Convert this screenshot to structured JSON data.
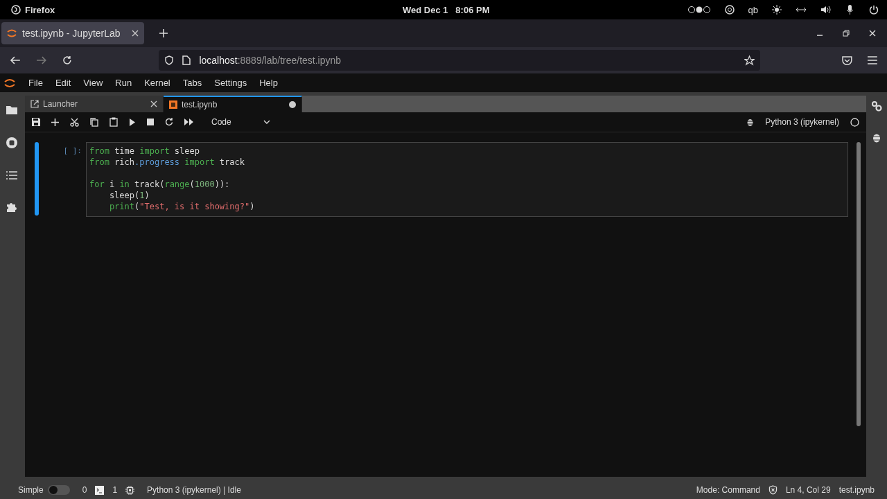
{
  "system_bar": {
    "app": "Firefox",
    "clock": "Wed Dec 1   8:06 PM",
    "tray_text": "qb"
  },
  "browser": {
    "tabs": [
      {
        "title": "test.ipynb - JupyterLab",
        "selected": true
      }
    ],
    "url": {
      "host": "localhost",
      "rest": ":8889/lab/tree/test.ipynb"
    }
  },
  "menu": [
    "File",
    "Edit",
    "View",
    "Run",
    "Kernel",
    "Tabs",
    "Settings",
    "Help"
  ],
  "doc_tabs": [
    {
      "title": "Launcher",
      "kind": "launcher",
      "selected": false,
      "dirty": false
    },
    {
      "title": "test.ipynb",
      "kind": "notebook",
      "selected": true,
      "dirty": true
    }
  ],
  "toolbar": {
    "cell_type": "Code",
    "kernel": "Python 3 (ipykernel)"
  },
  "cell": {
    "prompt": "[ ]:",
    "active": true,
    "lines": [
      {
        "kind": "code",
        "tokens": [
          {
            "t": "from",
            "kind": "keyword"
          },
          {
            "t": " time ",
            "kind": "plain"
          },
          {
            "t": "import",
            "kind": "keyword"
          },
          {
            "t": " sleep",
            "kind": "plain"
          }
        ]
      },
      {
        "kind": "code",
        "tokens": [
          {
            "t": "from",
            "kind": "keyword"
          },
          {
            "t": " rich",
            "kind": "plain"
          },
          {
            "t": ".progress",
            "kind": "module"
          },
          {
            "t": " import",
            "kind": "keyword"
          },
          {
            "t": " track",
            "kind": "plain"
          }
        ]
      },
      {
        "kind": "blank"
      },
      {
        "kind": "code",
        "tokens": [
          {
            "t": "for",
            "kind": "keyword"
          },
          {
            "t": " i ",
            "kind": "plain"
          },
          {
            "t": "in",
            "kind": "keyword"
          },
          {
            "t": " track(",
            "kind": "plain"
          },
          {
            "t": "range",
            "kind": "builtin"
          },
          {
            "t": "(",
            "kind": "plain"
          },
          {
            "t": "1000",
            "kind": "number"
          },
          {
            "t": ")):",
            "kind": "plain"
          }
        ]
      },
      {
        "kind": "code",
        "tokens": [
          {
            "t": "    sleep(",
            "kind": "plain"
          },
          {
            "t": "1",
            "kind": "number"
          },
          {
            "t": ")",
            "kind": "plain"
          }
        ]
      },
      {
        "kind": "code",
        "tokens": [
          {
            "t": "    print",
            "kind": "builtin"
          },
          {
            "t": "(",
            "kind": "plain"
          },
          {
            "t": "\"Test, is it showing?\"",
            "kind": "string"
          },
          {
            "t": ")",
            "kind": "plain"
          }
        ]
      }
    ]
  },
  "status_bar": {
    "mode_label": "Simple",
    "simple_on": false,
    "terminals": "0",
    "kernels": "1",
    "kernel_status": "Python 3 (ipykernel) | Idle",
    "mode": "Mode: Command",
    "position": "Ln 4, Col 29",
    "file": "test.ipynb"
  }
}
